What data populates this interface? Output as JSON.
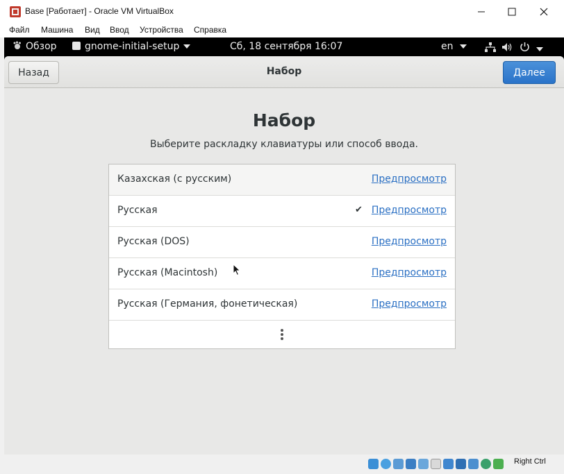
{
  "window": {
    "title": "Base [Работает] - Oracle VM VirtualBox",
    "menu": [
      "Файл",
      "Машина",
      "Вид",
      "Ввод",
      "Устройства",
      "Справка"
    ]
  },
  "gnome_bar": {
    "activities": "Обзор",
    "app_name": "gnome-initial-setup",
    "clock": "Сб, 18 сентября  16:07",
    "input_lang": "en"
  },
  "header": {
    "back_label": "Назад",
    "title": "Набор",
    "next_label": "Далее"
  },
  "page": {
    "title": "Набор",
    "subtitle": "Выберите раскладку клавиатуры или способ ввода."
  },
  "layouts": [
    {
      "label": "Казахская (с русским)",
      "preview": "Предпросмотр",
      "selected": false
    },
    {
      "label": "Русская",
      "preview": "Предпросмотр",
      "selected": true
    },
    {
      "label": "Русская (DOS)",
      "preview": "Предпросмотр",
      "selected": false
    },
    {
      "label": "Русская (Macintosh)",
      "preview": "Предпросмотр",
      "selected": false
    },
    {
      "label": "Русская (Германия, фонетическая)",
      "preview": "Предпросмотр",
      "selected": false
    }
  ],
  "status_bar": {
    "host_key": "Right Ctrl"
  },
  "colors": {
    "accent": "#2a73c9",
    "link": "#2a6fc3"
  }
}
